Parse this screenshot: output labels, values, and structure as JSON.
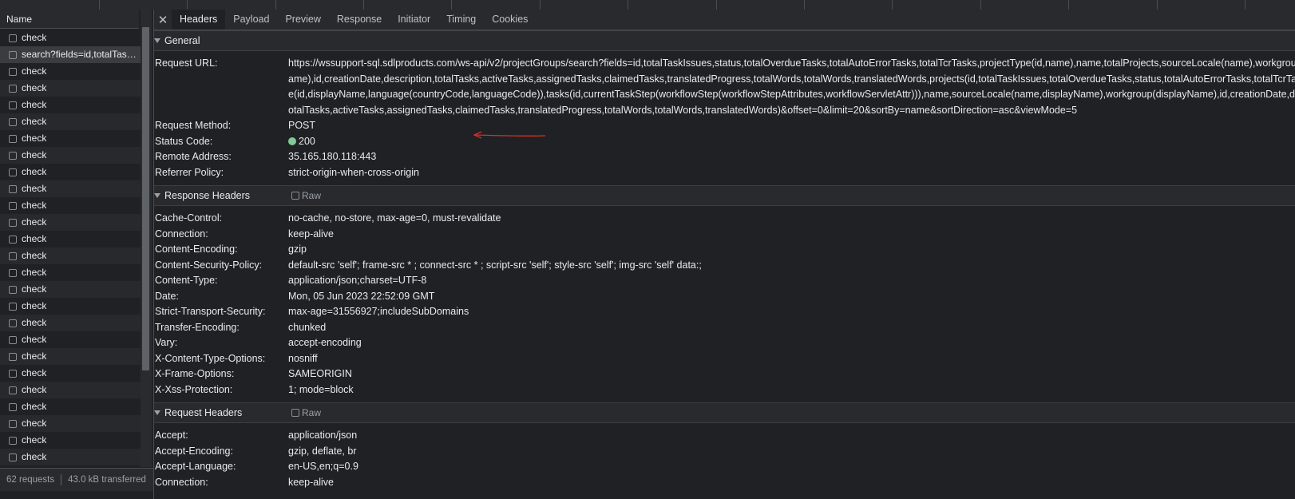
{
  "left_panel": {
    "column_header": "Name",
    "requests": [
      {
        "name": "check",
        "selected": false
      },
      {
        "name": "search?fields=id,totalTaskIssues,status,totalOverdueTasks,totalAutoErrorTasks",
        "selected": true
      },
      {
        "name": "check",
        "selected": false
      },
      {
        "name": "check",
        "selected": false
      },
      {
        "name": "check",
        "selected": false
      },
      {
        "name": "check",
        "selected": false
      },
      {
        "name": "check",
        "selected": false
      },
      {
        "name": "check",
        "selected": false
      },
      {
        "name": "check",
        "selected": false
      },
      {
        "name": "check",
        "selected": false
      },
      {
        "name": "check",
        "selected": false
      },
      {
        "name": "check",
        "selected": false
      },
      {
        "name": "check",
        "selected": false
      },
      {
        "name": "check",
        "selected": false
      },
      {
        "name": "check",
        "selected": false
      },
      {
        "name": "check",
        "selected": false
      },
      {
        "name": "check",
        "selected": false
      },
      {
        "name": "check",
        "selected": false
      },
      {
        "name": "check",
        "selected": false
      },
      {
        "name": "check",
        "selected": false
      },
      {
        "name": "check",
        "selected": false
      },
      {
        "name": "check",
        "selected": false
      },
      {
        "name": "check",
        "selected": false
      },
      {
        "name": "check",
        "selected": false
      },
      {
        "name": "check",
        "selected": false
      },
      {
        "name": "check",
        "selected": false
      }
    ],
    "status": {
      "requests": "62 requests",
      "transferred": "43.0 kB transferred"
    }
  },
  "tabs": [
    {
      "label": "Headers",
      "active": true
    },
    {
      "label": "Payload",
      "active": false
    },
    {
      "label": "Preview",
      "active": false
    },
    {
      "label": "Response",
      "active": false
    },
    {
      "label": "Initiator",
      "active": false
    },
    {
      "label": "Timing",
      "active": false
    },
    {
      "label": "Cookies",
      "active": false
    }
  ],
  "general": {
    "title": "General",
    "request_url_label": "Request URL:",
    "request_url_lines": [
      "https://wssupport-sql.sdlproducts.com/ws-api/v2/projectGroups/search?fields=id,totalTaskIssues,status,totalOverdueTasks,totalAutoErrorTasks,totalTcrTasks,projectType(id,name),name,totalProjects,sourceLocale(name),workgroup(displayN",
      "ame),id,creationDate,description,totalTasks,activeTasks,assignedTasks,claimedTasks,translatedProgress,totalWords,totalWords,translatedWords,projects(id,totalTaskIssues,totalOverdueTasks,status,totalAutoErrorTasks,totalTcrTasks,targetLoca",
      "e(id,displayName,language(countryCode,languageCode)),tasks(id,currentTaskStep(workflowStep(workflowStepAttributes,workflowServletAttr))),name,sourceLocale(name,displayName),workgroup(displayName),id,creationDate,description,t",
      "otalTasks,activeTasks,assignedTasks,claimedTasks,translatedProgress,totalWords,totalWords,translatedWords)&offset=0&limit=20&sortBy=name&sortDirection=asc&viewMode=5"
    ],
    "rows": [
      {
        "key": "Request Method:",
        "value": "POST"
      },
      {
        "key": "Status Code:",
        "value": "200",
        "status_color": "#81c995"
      },
      {
        "key": "Remote Address:",
        "value": "35.165.180.118:443"
      },
      {
        "key": "Referrer Policy:",
        "value": "strict-origin-when-cross-origin"
      }
    ]
  },
  "response_headers": {
    "title": "Response Headers",
    "raw_label": "Raw",
    "rows": [
      {
        "key": "Cache-Control:",
        "value": "no-cache, no-store, max-age=0, must-revalidate"
      },
      {
        "key": "Connection:",
        "value": "keep-alive"
      },
      {
        "key": "Content-Encoding:",
        "value": "gzip"
      },
      {
        "key": "Content-Security-Policy:",
        "value": "default-src 'self'; frame-src * ; connect-src * ; script-src 'self'; style-src 'self'; img-src 'self' data:;"
      },
      {
        "key": "Content-Type:",
        "value": "application/json;charset=UTF-8"
      },
      {
        "key": "Date:",
        "value": "Mon, 05 Jun 2023 22:52:09 GMT"
      },
      {
        "key": "Strict-Transport-Security:",
        "value": "max-age=31556927;includeSubDomains"
      },
      {
        "key": "Transfer-Encoding:",
        "value": "chunked"
      },
      {
        "key": "Vary:",
        "value": "accept-encoding"
      },
      {
        "key": "X-Content-Type-Options:",
        "value": "nosniff"
      },
      {
        "key": "X-Frame-Options:",
        "value": "SAMEORIGIN"
      },
      {
        "key": "X-Xss-Protection:",
        "value": "1; mode=block"
      }
    ]
  },
  "request_headers": {
    "title": "Request Headers",
    "raw_label": "Raw",
    "rows": [
      {
        "key": "Accept:",
        "value": "application/json"
      },
      {
        "key": "Accept-Encoding:",
        "value": "gzip, deflate, br"
      },
      {
        "key": "Accept-Language:",
        "value": "en-US,en;q=0.9"
      },
      {
        "key": "Connection:",
        "value": "keep-alive"
      }
    ]
  },
  "colors": {
    "background": "#202124",
    "panel_header": "#292a2d",
    "annotation": "#d93025",
    "status_ok": "#81c995"
  },
  "icons": {
    "close": "close-icon",
    "expand": "triangle-down-icon",
    "checkbox": "checkbox-icon",
    "status_dot": "status-dot-icon"
  }
}
